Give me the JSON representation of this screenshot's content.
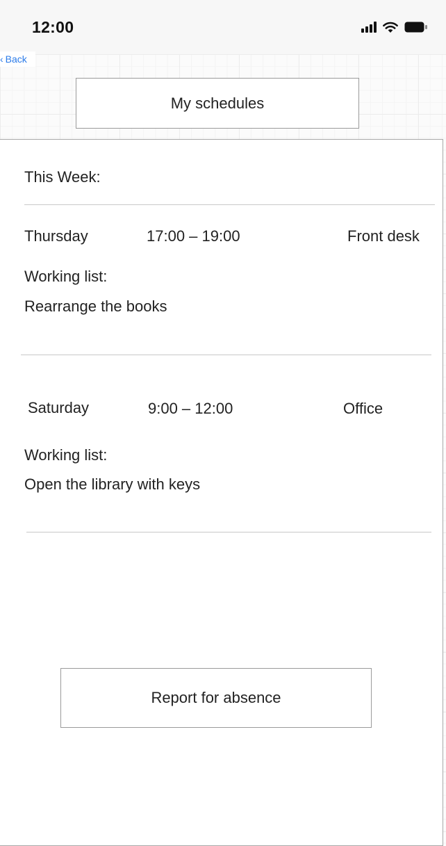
{
  "status_bar": {
    "time": "12:00",
    "icons": [
      "signal-icon",
      "wifi-icon",
      "battery-icon"
    ]
  },
  "nav": {
    "back_label": "Back"
  },
  "title": "My schedules",
  "section_heading": "This Week:",
  "schedules": [
    {
      "day": "Thursday",
      "time": "17:00 – 19:00",
      "location": "Front desk",
      "list_label": "Working list:",
      "task": "Rearrange the books"
    },
    {
      "day": "Saturday",
      "time": "9:00 – 12:00",
      "location": "Office",
      "list_label": "Working list:",
      "task": "Open the library with keys"
    }
  ],
  "report_button_label": "Report for absence",
  "colors": {
    "accent": "#2b7be9",
    "border": "#9a9a9a",
    "divider": "#c8c8c8"
  }
}
